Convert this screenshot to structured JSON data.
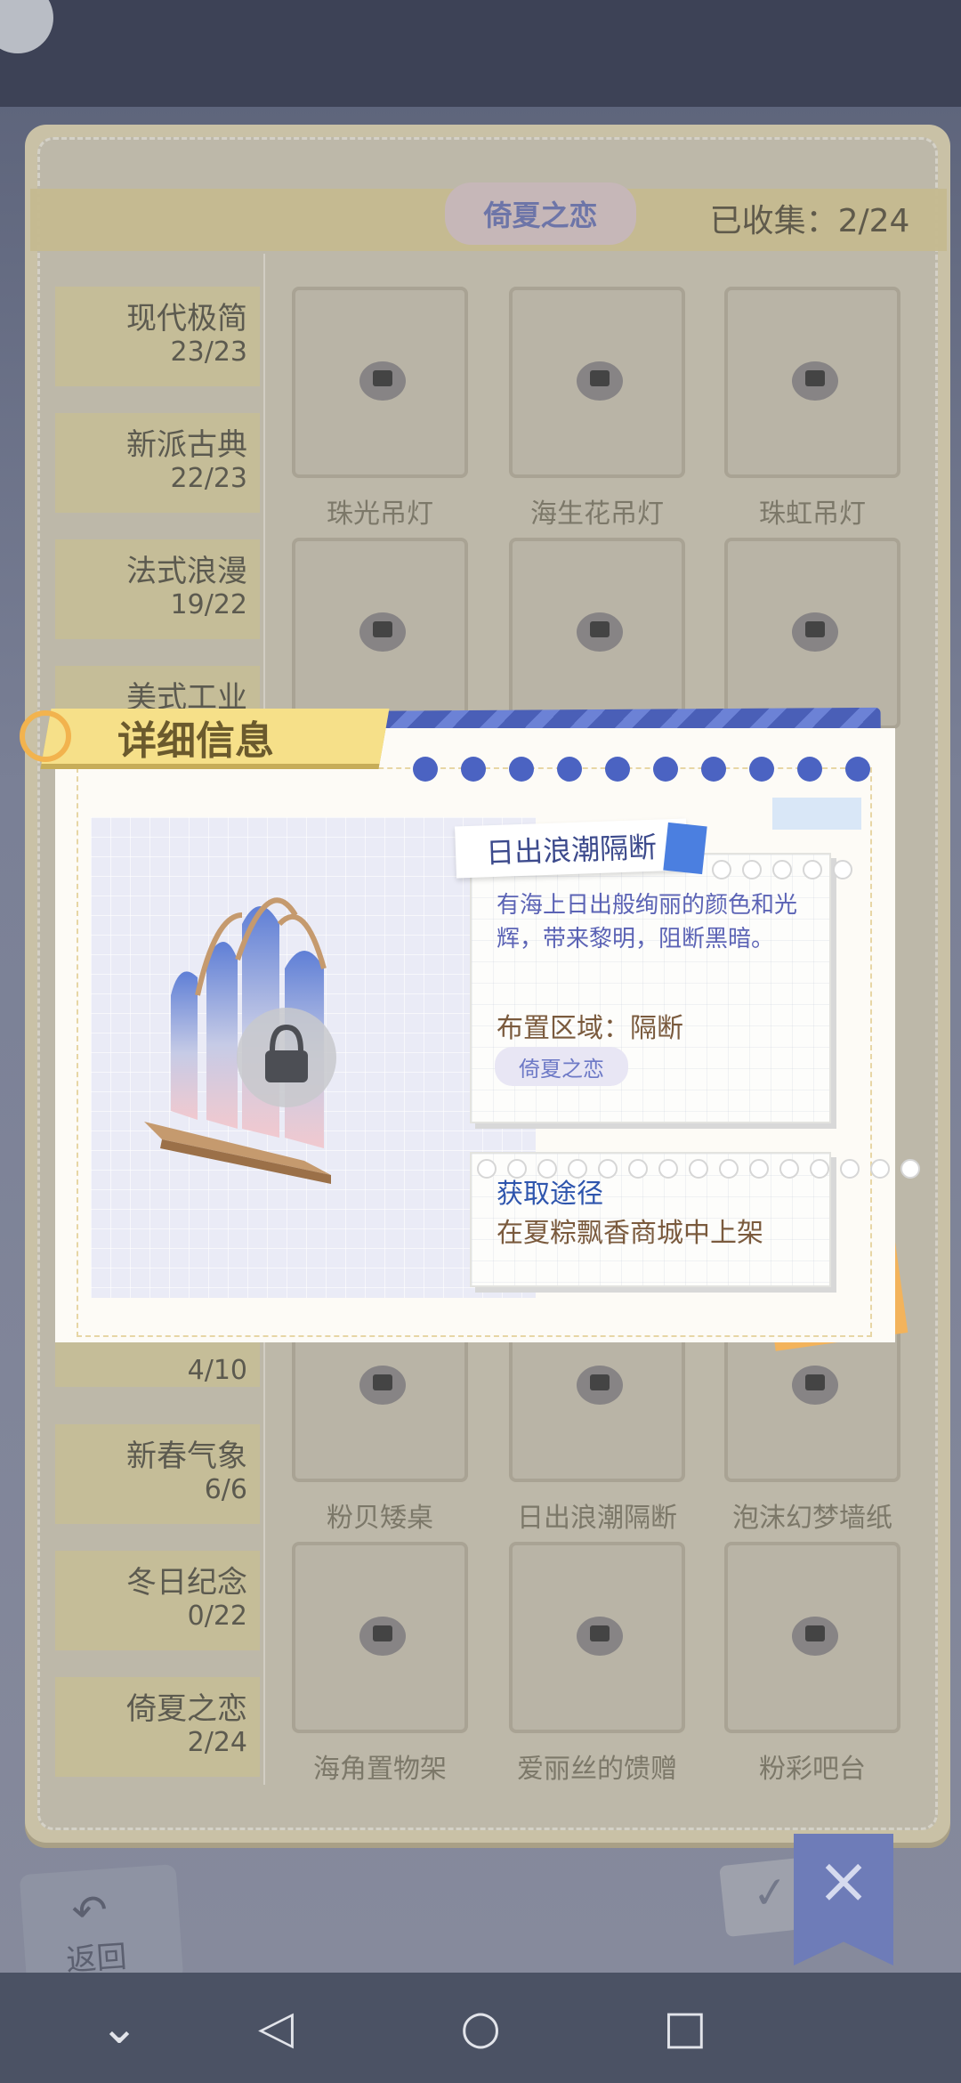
{
  "header": {
    "theme_logo": "倚夏之恋",
    "collected": "已收集：2/24"
  },
  "sidebar": {
    "categories": [
      {
        "name": "现代极简",
        "count": "23/23"
      },
      {
        "name": "新派古典",
        "count": "22/23"
      },
      {
        "name": "法式浪漫",
        "count": "19/22"
      },
      {
        "name": "美式工业",
        "count": ""
      },
      {
        "name": "",
        "count": "4/10"
      },
      {
        "name": "新春气象",
        "count": "6/6"
      },
      {
        "name": "冬日纪念",
        "count": "0/22"
      },
      {
        "name": "倚夏之恋",
        "count": "2/24"
      }
    ]
  },
  "items": [
    {
      "label": "珠光吊灯"
    },
    {
      "label": "海生花吊灯"
    },
    {
      "label": "珠虹吊灯"
    },
    {
      "label": ""
    },
    {
      "label": ""
    },
    {
      "label": ""
    },
    {
      "label": "粉贝矮桌"
    },
    {
      "label": "日出浪潮隔断"
    },
    {
      "label": "泡沫幻梦墙纸"
    },
    {
      "label": "海角置物架"
    },
    {
      "label": "爱丽丝的馈赠"
    },
    {
      "label": "粉彩吧台"
    }
  ],
  "dialog": {
    "title": "详细信息",
    "item_name": "日出浪潮隔断",
    "description": "有海上日出般绚丽的颜色和光辉，带来黎明，阻断黑暗。",
    "area": "布置区域：隔断",
    "theme_badge": "倚夏之恋",
    "source_heading": "获取途径",
    "source_value": "在夏粽飘香商城中上架"
  },
  "controls": {
    "back_label": "返回",
    "close_icon": "×",
    "ok_icon": "✓"
  },
  "navbar": {
    "down": "⌄",
    "back": "◁",
    "home": "○",
    "recents": "□"
  },
  "colors": {
    "accent_blue": "#4b63c2",
    "ribbon_yellow": "#f6e089",
    "tape_orange": "#f3b35b",
    "desc_text": "#5b63b5",
    "body_text": "#7a5a3d"
  }
}
